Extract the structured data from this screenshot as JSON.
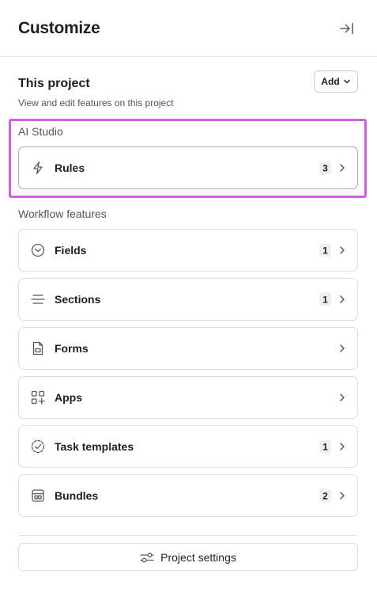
{
  "header": {
    "title": "Customize"
  },
  "project": {
    "title": "This project",
    "subtitle": "View and edit features on this project",
    "add_label": "Add"
  },
  "ai_studio": {
    "label": "AI Studio",
    "items": [
      {
        "label": "Rules",
        "count": "3",
        "icon": "lightning-icon"
      }
    ]
  },
  "workflow": {
    "label": "Workflow features",
    "items": [
      {
        "label": "Fields",
        "count": "1",
        "icon": "circle-chevron-icon"
      },
      {
        "label": "Sections",
        "count": "1",
        "icon": "sections-lines-icon"
      },
      {
        "label": "Forms",
        "count": "",
        "icon": "form-document-icon"
      },
      {
        "label": "Apps",
        "count": "",
        "icon": "apps-grid-icon"
      },
      {
        "label": "Task templates",
        "count": "1",
        "icon": "dashed-check-circle-icon"
      },
      {
        "label": "Bundles",
        "count": "2",
        "icon": "bundle-icon"
      }
    ]
  },
  "footer": {
    "settings_label": "Project settings"
  },
  "colors": {
    "highlight": "#d05fe5",
    "text": "#1e1f21",
    "badge_bg": "#f0efef"
  }
}
